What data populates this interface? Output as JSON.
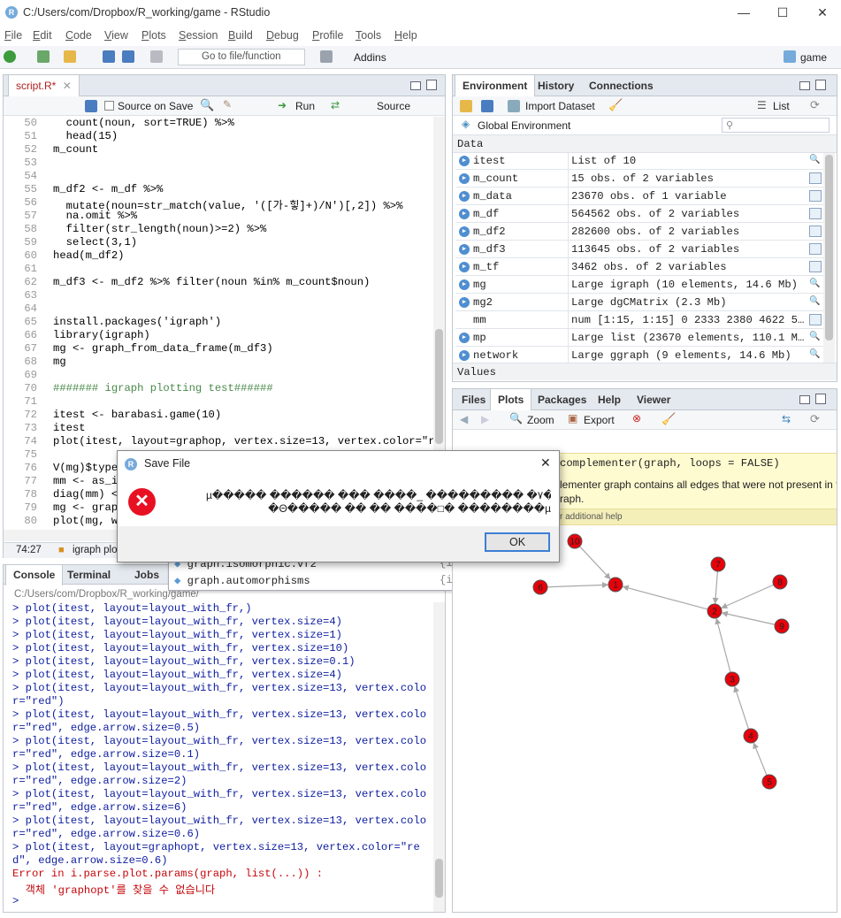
{
  "window": {
    "title": "C:/Users/com/Dropbox/R_working/game - RStudio",
    "min": "—",
    "max": "☐",
    "close": "✕"
  },
  "menu": [
    {
      "u": "F",
      "rest": "ile"
    },
    {
      "u": "E",
      "rest": "dit"
    },
    {
      "u": "C",
      "rest": "ode"
    },
    {
      "u": "V",
      "rest": "iew"
    },
    {
      "u": "P",
      "rest": "lots"
    },
    {
      "u": "S",
      "rest": "ession"
    },
    {
      "u": "B",
      "rest": "uild"
    },
    {
      "u": "D",
      "rest": "ebug"
    },
    {
      "u": "P",
      "rest": "rofile"
    },
    {
      "u": "T",
      "rest": "ools"
    },
    {
      "u": "H",
      "rest": "elp"
    }
  ],
  "toolbar": {
    "goto": "Go to file/function",
    "addins": "Addins",
    "project": "game"
  },
  "editor": {
    "tab": "script.R*",
    "source_on_save": "Source on Save",
    "run": "Run",
    "source": "Source",
    "lines": [
      {
        "n": "50",
        "t": "  count(noun, sort=TRUE) %>%"
      },
      {
        "n": "51",
        "t": "  head(15)"
      },
      {
        "n": "52",
        "t": "m_count"
      },
      {
        "n": "53",
        "t": ""
      },
      {
        "n": "54",
        "t": ""
      },
      {
        "n": "55",
        "t": "m_df2 <- m_df %>%"
      },
      {
        "n": "56",
        "t": "  mutate(noun=str_match(value, '([가-힣]+)/N')[,2]) %>%"
      },
      {
        "n": "57",
        "t": "  na.omit %>%"
      },
      {
        "n": "58",
        "t": "  filter(str_length(noun)>=2) %>%"
      },
      {
        "n": "59",
        "t": "  select(3,1)"
      },
      {
        "n": "60",
        "t": "head(m_df2)"
      },
      {
        "n": "61",
        "t": ""
      },
      {
        "n": "62",
        "t": "m_df3 <- m_df2 %>% filter(noun %in% m_count$noun)"
      },
      {
        "n": "63",
        "t": ""
      },
      {
        "n": "64",
        "t": ""
      },
      {
        "n": "65",
        "t": "install.packages('igraph')"
      },
      {
        "n": "66",
        "t": "library(igraph)"
      },
      {
        "n": "67",
        "t": "mg <- graph_from_data_frame(m_df3)"
      },
      {
        "n": "68",
        "t": "mg"
      },
      {
        "n": "69",
        "t": ""
      },
      {
        "n": "70",
        "t": "####### igraph plotting test######"
      },
      {
        "n": "71",
        "t": ""
      },
      {
        "n": "72",
        "t": "itest <- barabasi.game(10)"
      },
      {
        "n": "73",
        "t": "itest"
      },
      {
        "n": "74",
        "t": "plot(itest, layout=graphop, vertex.size=13, vertex.color=\"r"
      },
      {
        "n": "75",
        "t": ""
      },
      {
        "n": "76",
        "t": "V(mg)$type"
      },
      {
        "n": "77",
        "t": "mm <- as_in"
      },
      {
        "n": "78",
        "t": "diag(mm) <"
      },
      {
        "n": "79",
        "t": "mg <- graph"
      },
      {
        "n": "80",
        "t": "plot(mg, w"
      },
      {
        "n": "81",
        "t": ""
      }
    ],
    "status_pos": "74:27",
    "status_ctx": "igraph plo"
  },
  "autocomplete": {
    "items": [
      {
        "name": "graph.isomorphic.vf2",
        "pkg": "{igraph}"
      },
      {
        "name": "graph.automorphisms",
        "pkg": "{igraph}"
      }
    ]
  },
  "console": {
    "tabs": [
      "Console",
      "Terminal",
      "Jobs"
    ],
    "path": "C:/Users/com/Dropbox/R_working/game/",
    "lines": [
      "> plot(itest, layout=layout_with_fr,)",
      "> plot(itest, layout=layout_with_fr, vertex.size=4)",
      "> plot(itest, layout=layout_with_fr, vertex.size=1)",
      "> plot(itest, layout=layout_with_fr, vertex.size=10)",
      "> plot(itest, layout=layout_with_fr, vertex.size=0.1)",
      "> plot(itest, layout=layout_with_fr, vertex.size=4)",
      "> plot(itest, layout=layout_with_fr, vertex.size=13, vertex.colo",
      "r=\"red\")",
      "> plot(itest, layout=layout_with_fr, vertex.size=13, vertex.colo",
      "r=\"red\", edge.arrow.size=0.5)",
      "> plot(itest, layout=layout_with_fr, vertex.size=13, vertex.colo",
      "r=\"red\", edge.arrow.size=0.1)",
      "> plot(itest, layout=layout_with_fr, vertex.size=13, vertex.colo",
      "r=\"red\", edge.arrow.size=2)",
      "> plot(itest, layout=layout_with_fr, vertex.size=13, vertex.colo",
      "r=\"red\", edge.arrow.size=6)",
      "> plot(itest, layout=layout_with_fr, vertex.size=13, vertex.colo",
      "r=\"red\", edge.arrow.size=0.6)",
      "> plot(itest, layout=graphopt, vertex.size=13, vertex.color=\"re",
      "d\", edge.arrow.size=0.6)"
    ],
    "error1": "Error in i.parse.plot.params(graph, list(...)) :",
    "error2": "  객체 'graphopt'를 찾을 수 없습니다",
    "prompt": ">"
  },
  "env": {
    "tabs": [
      "Environment",
      "History",
      "Connections"
    ],
    "import": "Import Dataset",
    "list": "List",
    "scope": "Global Environment",
    "section": "Data",
    "values": "Values",
    "rows": [
      {
        "name": "itest",
        "value": "List of 10",
        "act": "search"
      },
      {
        "name": "m_count",
        "value": "15 obs. of 2 variables",
        "act": "table"
      },
      {
        "name": "m_data",
        "value": "23670 obs. of 1 variable",
        "act": "table"
      },
      {
        "name": "m_df",
        "value": "564562 obs. of 2 variables",
        "act": "table"
      },
      {
        "name": "m_df2",
        "value": "282600 obs. of 2 variables",
        "act": "table"
      },
      {
        "name": "m_df3",
        "value": "113645 obs. of 2 variables",
        "act": "table"
      },
      {
        "name": "m_tf",
        "value": "3462 obs. of 2 variables",
        "act": "table"
      },
      {
        "name": "mg",
        "value": "Large igraph (10 elements, 14.6 Mb)",
        "act": "search"
      },
      {
        "name": "mg2",
        "value": "Large dgCMatrix (2.3 Mb)",
        "act": "search"
      },
      {
        "name": "mm",
        "value": "num [1:15, 1:15] 0 2333 2380 4622 5…",
        "act": "table",
        "nodot": true
      },
      {
        "name": "mp",
        "value": "Large list (23670 elements, 110.1 M…",
        "act": "search"
      },
      {
        "name": "network",
        "value": "Large ggraph (9 elements, 14.6 Mb)",
        "act": "search"
      }
    ]
  },
  "files": {
    "tabs": [
      "Files",
      "Plots",
      "Packages",
      "Help",
      "Viewer"
    ],
    "zoom": "Zoom",
    "export": "Export",
    "help_sig": "complementer(graph, loops = FALSE)",
    "help_desc1": "lementer graph contains all edges that were not present in t",
    "help_desc2": "raph.",
    "help_more": "r additional help",
    "nodes": [
      "1",
      "2",
      "3",
      "4",
      "5",
      "6",
      "7",
      "8",
      "9",
      "10"
    ]
  },
  "dialog": {
    "title": "Save File",
    "msg1": "µ����� ������ ��� ����_ ��������� �۷�",
    "msg2": "�Θ����� �� �� ����□� ��������µ",
    "ok": "OK",
    "close": "✕"
  },
  "colors": {
    "accent": "#75aadb",
    "error": "#c5060b",
    "node": "#e8000a"
  }
}
